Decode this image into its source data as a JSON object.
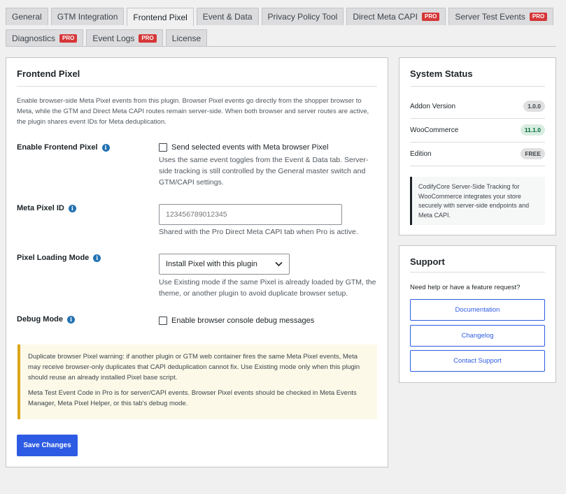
{
  "tabs_row1": [
    {
      "label": "General",
      "pro": false,
      "active": false
    },
    {
      "label": "GTM Integration",
      "pro": false,
      "active": false
    },
    {
      "label": "Frontend Pixel",
      "pro": false,
      "active": true
    },
    {
      "label": "Event & Data",
      "pro": false,
      "active": false
    },
    {
      "label": "Privacy Policy Tool",
      "pro": false,
      "active": false
    },
    {
      "label": "Direct Meta CAPI",
      "pro": true,
      "active": false
    },
    {
      "label": "Server Test Events",
      "pro": true,
      "active": false
    }
  ],
  "tabs_row2": [
    {
      "label": "Diagnostics",
      "pro": true,
      "active": false
    },
    {
      "label": "Event Logs",
      "pro": true,
      "active": false
    },
    {
      "label": "License",
      "pro": false,
      "active": false
    }
  ],
  "pro_badge": "PRO",
  "main": {
    "title": "Frontend Pixel",
    "intro": "Enable browser-side Meta Pixel events from this plugin. Browser Pixel events go directly from the shopper browser to Meta, while the GTM and Direct Meta CAPI routes remain server-side. When both browser and server routes are active, the plugin shares event IDs for Meta deduplication.",
    "enable_label": "Enable Frontend Pixel",
    "enable_checkbox_label": "Send selected events with Meta browser Pixel",
    "enable_checked": false,
    "enable_help": "Uses the same event toggles from the Event & Data tab. Server-side tracking is still controlled by the General master switch and GTM/CAPI settings.",
    "pixel_id_label": "Meta Pixel ID",
    "pixel_id_placeholder": "123456789012345",
    "pixel_id_help": "Shared with the Pro Direct Meta CAPI tab when Pro is active.",
    "loading_label": "Pixel Loading Mode",
    "loading_value": "Install Pixel with this plugin",
    "loading_help": "Use Existing mode if the same Pixel is already loaded by GTM, the theme, or another plugin to avoid duplicate browser setup.",
    "debug_label": "Debug Mode",
    "debug_checkbox_label": "Enable browser console debug messages",
    "debug_checked": false,
    "notice_p1": "Duplicate browser Pixel warning: if another plugin or GTM web container fires the same Meta Pixel events, Meta may receive browser-only duplicates that CAPI deduplication cannot fix. Use Existing mode only when this plugin should reuse an already installed Pixel base script.",
    "notice_p2": "Meta Test Event Code in Pro is for server/CAPI events. Browser Pixel events should be checked in Meta Events Manager, Meta Pixel Helper, or this tab's debug mode.",
    "save_label": "Save Changes"
  },
  "status": {
    "title": "System Status",
    "rows": [
      {
        "label": "Addon Version",
        "value": "1.0.0",
        "tone": "gray"
      },
      {
        "label": "WooCommerce",
        "value": "11.1.0",
        "tone": "green"
      },
      {
        "label": "Edition",
        "value": "FREE",
        "tone": "gray"
      }
    ],
    "note": "CodifyCore Server-Side Tracking for WooCommerce integrates your store securely with server-side endpoints and Meta CAPI."
  },
  "support": {
    "title": "Support",
    "text": "Need help or have a feature request?",
    "buttons": [
      "Documentation",
      "Changelog",
      "Contact Support"
    ]
  },
  "colors": {
    "accent": "#2d5be3",
    "pro_badge": "#d63638",
    "notice_border": "#dba617",
    "notice_bg": "#fcf9e8",
    "info_icon": "#2271b1"
  }
}
